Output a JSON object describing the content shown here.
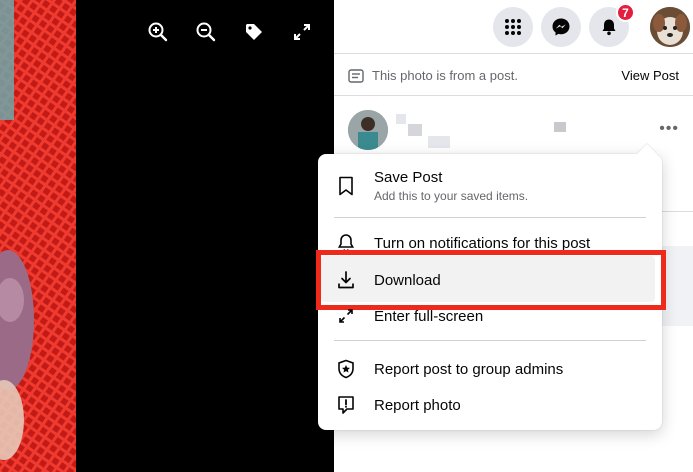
{
  "topbar": {
    "notifications_count": "7"
  },
  "post_notice": {
    "text": "This photo is from a post.",
    "view_post": "View Post"
  },
  "menu": {
    "items": [
      {
        "title": "Save Post",
        "subtitle": "Add this to your saved items."
      },
      {
        "title": "Turn on notifications for this post"
      },
      {
        "title": "Download"
      },
      {
        "title": "Enter full-screen"
      },
      {
        "title": "Report post to group admins"
      },
      {
        "title": "Report photo"
      }
    ]
  },
  "colors": {
    "highlight": "#ee2a1c",
    "badge": "#e41e3f",
    "panel_bg": "#ffffff"
  }
}
